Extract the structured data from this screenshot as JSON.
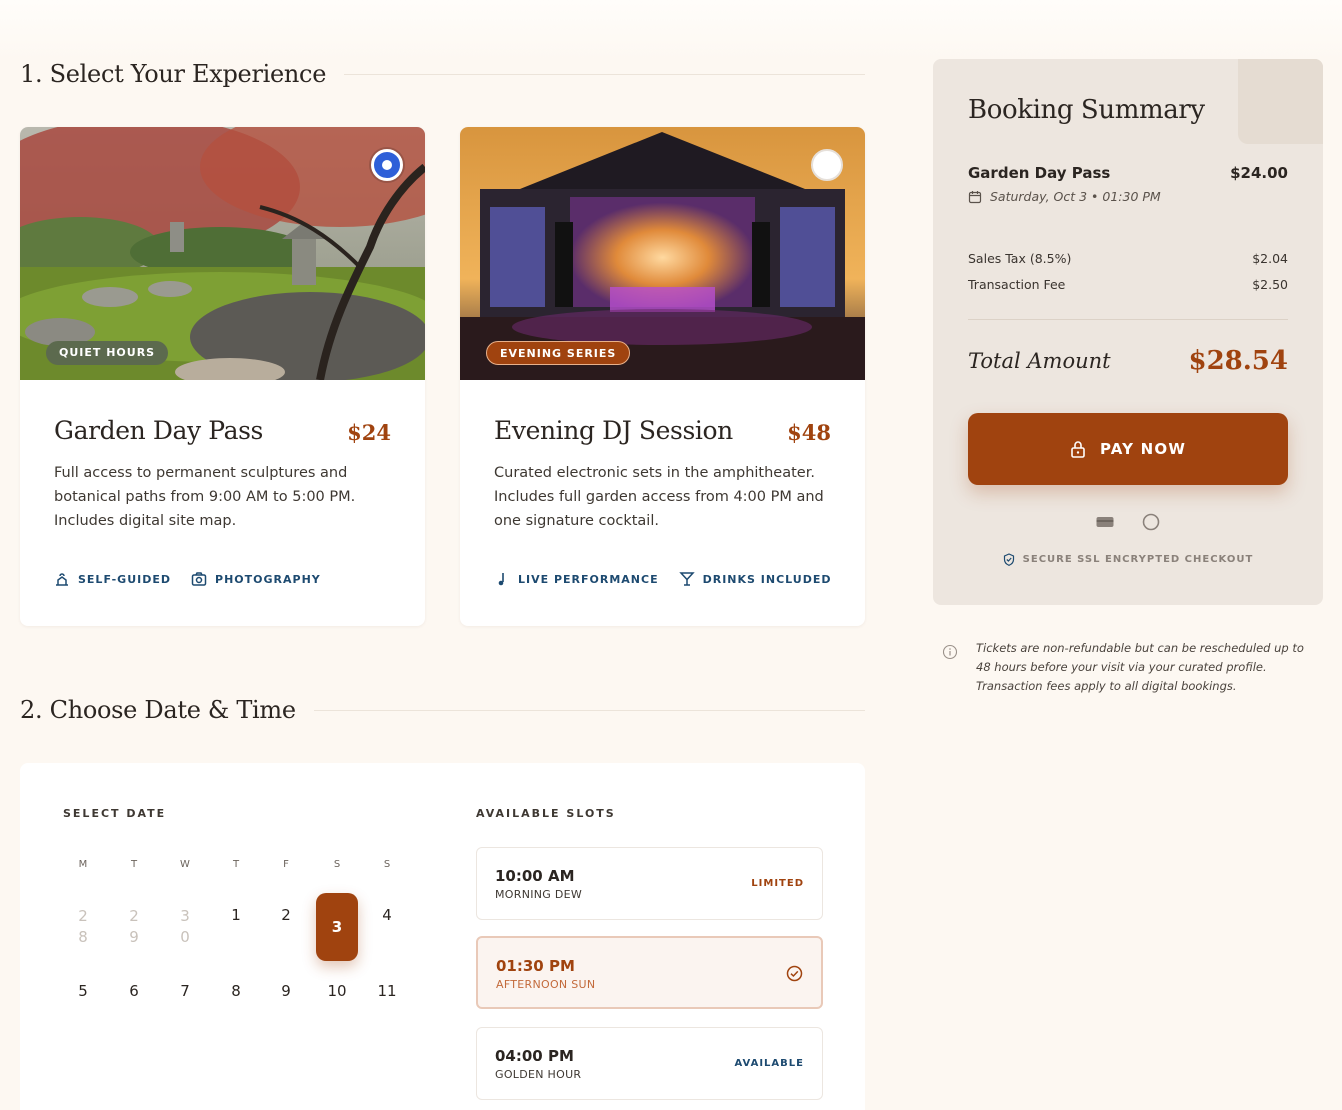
{
  "sections": {
    "experience_title": "1. Select Your Experience",
    "datetime_title": "2. Choose Date & Time"
  },
  "experiences": [
    {
      "badge": "QUIET HOURS",
      "title": "Garden Day Pass",
      "price": "$24",
      "description": "Full access to permanent sculptures and botanical paths from 9:00 AM to 5:00 PM. Includes digital site map.",
      "features": [
        "SELF-GUIDED",
        "PHOTOGRAPHY"
      ],
      "selected": true
    },
    {
      "badge": "EVENING SERIES",
      "title": "Evening DJ Session",
      "price": "$48",
      "description": "Curated electronic sets in the amphitheater. Includes full garden access from 4:00 PM and one signature cocktail.",
      "features": [
        "LIVE PERFORMANCE",
        "DRINKS INCLUDED"
      ],
      "selected": false
    }
  ],
  "calendar": {
    "label": "SELECT DATE",
    "weekdays": [
      "M",
      "T",
      "W",
      "T",
      "F",
      "S",
      "S"
    ],
    "prev_month_days": [
      "2\n8",
      "2\n9",
      "3\n0"
    ],
    "week1": [
      "1",
      "2",
      "3",
      "4"
    ],
    "week2": [
      "5",
      "6",
      "7",
      "8",
      "9",
      "10",
      "11"
    ],
    "selected_day": "3"
  },
  "slots": {
    "label": "AVAILABLE SLOTS",
    "items": [
      {
        "time": "10:00 AM",
        "name": "MORNING DEW",
        "status": "LIMITED"
      },
      {
        "time": "01:30 PM",
        "name": "AFTERNOON SUN",
        "status": ""
      },
      {
        "time": "04:00 PM",
        "name": "GOLDEN HOUR",
        "status": "AVAILABLE"
      }
    ]
  },
  "summary": {
    "title": "Booking Summary",
    "item_name": "Garden Day Pass",
    "item_price": "$24.00",
    "item_date": "Saturday, Oct 3 • 01:30 PM",
    "tax_label": "Sales Tax (8.5%)",
    "tax_value": "$2.04",
    "fee_label": "Transaction Fee",
    "fee_value": "$2.50",
    "total_label": "Total Amount",
    "total_value": "$28.54",
    "pay_label": "PAY NOW",
    "secure_text": "SECURE SSL ENCRYPTED CHECKOUT"
  },
  "note": "Tickets are non-refundable but can be rescheduled up to 48 hours before your visit via your curated profile. Transaction fees apply to all digital bookings.",
  "colors": {
    "accent": "#a0430f",
    "feature_text": "#1d4a70",
    "background": "#fdf8f2",
    "summary_bg": "#ede6df"
  }
}
